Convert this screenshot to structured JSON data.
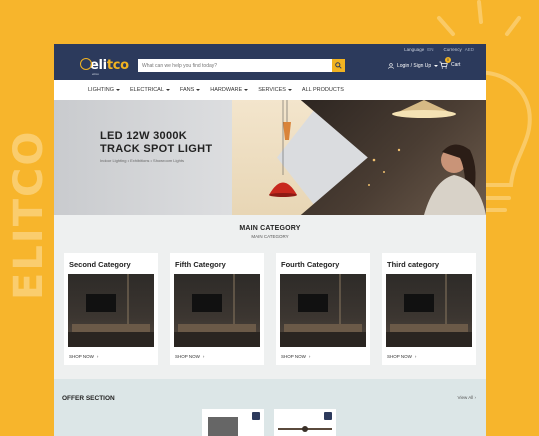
{
  "side_text": "ELITCO",
  "site": {
    "logo": {
      "prefix": "eli",
      "accent": "tco",
      "tagline": "elitco"
    },
    "topbar": {
      "language_label": "Language",
      "language_value": "EN",
      "currency_label": "Currency",
      "currency_value": "AED"
    },
    "search": {
      "placeholder": "What can we help you find today?"
    },
    "account_label": "Login / Sign Up",
    "cart": {
      "label": "Cart",
      "count": "0"
    },
    "nav": [
      {
        "label": "LIGHTING",
        "dropdown": true
      },
      {
        "label": "ELECTRICAL",
        "dropdown": true
      },
      {
        "label": "FANS",
        "dropdown": true
      },
      {
        "label": "HARDWARE",
        "dropdown": true
      },
      {
        "label": "SERVICES",
        "dropdown": true
      },
      {
        "label": "ALL PRODUCTS",
        "dropdown": false
      }
    ],
    "hero": {
      "title_line1": "LED 12W 3000K",
      "title_line2": "TRACK SPOT LIGHT",
      "subtitle": "Indoor Lighting • Exhibitions • Showroom Lights"
    },
    "main_category": {
      "title": "MAIN CATEGORY",
      "subtitle": "MAIN CATEGORY",
      "cards": [
        {
          "title": "Second Category",
          "link": "SHOP NOW"
        },
        {
          "title": "Fifth Category",
          "link": "SHOP NOW"
        },
        {
          "title": "Fourth Category",
          "link": "SHOP NOW"
        },
        {
          "title": "Third category",
          "link": "SHOP NOW"
        }
      ]
    },
    "offer": {
      "title": "OFFER SECTION",
      "view_all": "View All"
    }
  },
  "colors": {
    "background": "#f7b52c",
    "navy": "#2c3a5c",
    "accent": "#f2b321"
  }
}
